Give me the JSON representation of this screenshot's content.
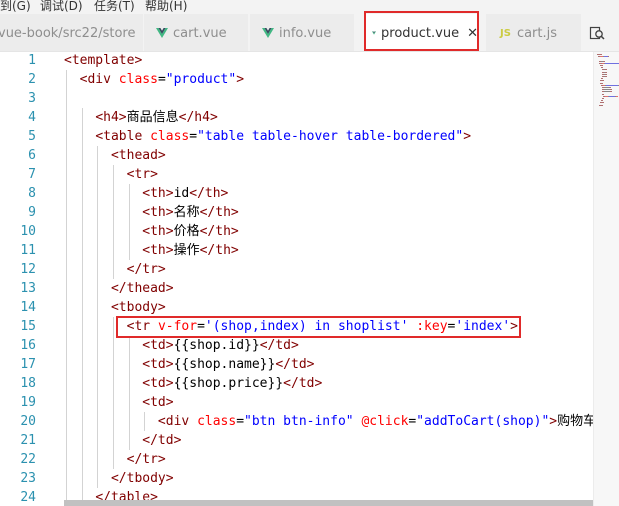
{
  "menubar": {
    "items": [
      "到(G)",
      "调试(D)",
      "任务(T)",
      "帮助(H)"
    ]
  },
  "tabs": [
    {
      "label": "vue-book/src22/store",
      "icon": "none",
      "state": "inactive"
    },
    {
      "label": "cart.vue",
      "icon": "vue-icon",
      "state": "inactive"
    },
    {
      "label": "info.vue",
      "icon": "vue-icon",
      "state": "inactive"
    },
    {
      "label": "product.vue",
      "icon": "vue-icon",
      "state": "active",
      "close": "✕"
    },
    {
      "label": "cart.js",
      "icon": "js-icon",
      "state": "inactive",
      "badge": "JS"
    }
  ],
  "colors": {
    "tag": "#800000",
    "attribute": "#ff0000",
    "string": "#0000ff",
    "line_number": "#2b91af",
    "highlight": "#e02a2a",
    "vue_green": "#41b883"
  },
  "editor": {
    "line_numbers": [
      "1",
      "2",
      "3",
      "4",
      "5",
      "6",
      "7",
      "8",
      "9",
      "10",
      "11",
      "12",
      "13",
      "14",
      "15",
      "16",
      "17",
      "18",
      "19",
      "20",
      "21",
      "22",
      "23",
      "24"
    ],
    "lines": [
      {
        "indent": "",
        "tokens": [
          [
            "tag",
            "<template>"
          ]
        ]
      },
      {
        "indent": "  ",
        "tokens": [
          [
            "tag",
            "<div "
          ],
          [
            "attr",
            "class"
          ],
          [
            "txt",
            "="
          ],
          [
            "str",
            "\"product\""
          ],
          [
            "tag",
            ">"
          ]
        ]
      },
      {
        "indent": "",
        "tokens": []
      },
      {
        "indent": "    ",
        "tokens": [
          [
            "tag",
            "<h4>"
          ],
          [
            "txt",
            "商品信息"
          ],
          [
            "tag",
            "</h4>"
          ]
        ]
      },
      {
        "indent": "    ",
        "tokens": [
          [
            "tag",
            "<table "
          ],
          [
            "attr",
            "class"
          ],
          [
            "txt",
            "="
          ],
          [
            "str",
            "\"table table-hover table-bordered\""
          ],
          [
            "tag",
            ">"
          ]
        ]
      },
      {
        "indent": "      ",
        "tokens": [
          [
            "tag",
            "<thead>"
          ]
        ]
      },
      {
        "indent": "        ",
        "tokens": [
          [
            "tag",
            "<tr>"
          ]
        ]
      },
      {
        "indent": "          ",
        "tokens": [
          [
            "tag",
            "<th>"
          ],
          [
            "txt",
            "id"
          ],
          [
            "tag",
            "</th>"
          ]
        ]
      },
      {
        "indent": "          ",
        "tokens": [
          [
            "tag",
            "<th>"
          ],
          [
            "txt",
            "名称"
          ],
          [
            "tag",
            "</th>"
          ]
        ]
      },
      {
        "indent": "          ",
        "tokens": [
          [
            "tag",
            "<th>"
          ],
          [
            "txt",
            "价格"
          ],
          [
            "tag",
            "</th>"
          ]
        ]
      },
      {
        "indent": "          ",
        "tokens": [
          [
            "tag",
            "<th>"
          ],
          [
            "txt",
            "操作"
          ],
          [
            "tag",
            "</th>"
          ]
        ]
      },
      {
        "indent": "        ",
        "tokens": [
          [
            "tag",
            "</tr>"
          ]
        ]
      },
      {
        "indent": "      ",
        "tokens": [
          [
            "tag",
            "</thead>"
          ]
        ]
      },
      {
        "indent": "      ",
        "tokens": [
          [
            "tag",
            "<tbody>"
          ]
        ]
      },
      {
        "indent": "        ",
        "tokens": [
          [
            "tag",
            "<tr "
          ],
          [
            "attr",
            "v-for"
          ],
          [
            "txt",
            "="
          ],
          [
            "str",
            "'(shop,index) in shoplist'"
          ],
          [
            "txt",
            " "
          ],
          [
            "attr",
            ":key"
          ],
          [
            "txt",
            "="
          ],
          [
            "str",
            "'index'"
          ],
          [
            "tag",
            ">"
          ]
        ]
      },
      {
        "indent": "          ",
        "tokens": [
          [
            "tag",
            "<td>"
          ],
          [
            "txt",
            "{{shop.id}}"
          ],
          [
            "tag",
            "</td>"
          ]
        ]
      },
      {
        "indent": "          ",
        "tokens": [
          [
            "tag",
            "<td>"
          ],
          [
            "txt",
            "{{shop.name}}"
          ],
          [
            "tag",
            "</td>"
          ]
        ]
      },
      {
        "indent": "          ",
        "tokens": [
          [
            "tag",
            "<td>"
          ],
          [
            "txt",
            "{{shop.price}}"
          ],
          [
            "tag",
            "</td>"
          ]
        ]
      },
      {
        "indent": "          ",
        "tokens": [
          [
            "tag",
            "<td>"
          ]
        ]
      },
      {
        "indent": "            ",
        "tokens": [
          [
            "tag",
            "<div "
          ],
          [
            "attr",
            "class"
          ],
          [
            "txt",
            "="
          ],
          [
            "str",
            "\"btn btn-info\""
          ],
          [
            "txt",
            " "
          ],
          [
            "attr",
            "@click"
          ],
          [
            "txt",
            "="
          ],
          [
            "str",
            "\"addToCart(shop)\""
          ],
          [
            "tag",
            ">"
          ],
          [
            "txt",
            "购物车"
          ],
          [
            "tag",
            "<"
          ]
        ]
      },
      {
        "indent": "          ",
        "tokens": [
          [
            "tag",
            "</td>"
          ]
        ]
      },
      {
        "indent": "        ",
        "tokens": [
          [
            "tag",
            "</tr>"
          ]
        ]
      },
      {
        "indent": "      ",
        "tokens": [
          [
            "tag",
            "</tbody>"
          ]
        ]
      },
      {
        "indent": "    ",
        "tokens": [
          [
            "tag",
            "</table>"
          ]
        ]
      }
    ]
  }
}
